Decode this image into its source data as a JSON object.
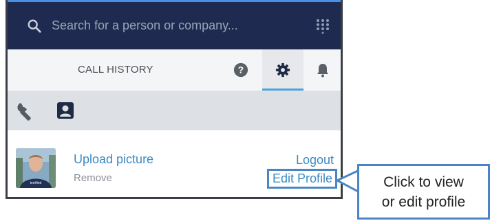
{
  "search": {
    "placeholder": "Search for a person or company..."
  },
  "tabs": {
    "call_history_label": "CALL HISTORY"
  },
  "profile": {
    "upload_label": "Upload picture",
    "remove_label": "Remove",
    "logout_label": "Logout",
    "edit_profile_label": "Edit Profile"
  },
  "callout": {
    "line1": "Click to view",
    "line2": "or edit profile"
  },
  "icons": {
    "search": "search-icon",
    "dialpad": "dialpad-icon",
    "help": "help-icon",
    "settings": "gear-icon",
    "notifications": "bell-icon",
    "tools": "wrench-icon",
    "contact_card": "contact-card-icon"
  },
  "colors": {
    "search_bar_bg": "#1e2a4f",
    "accent_blue": "#4a86c5",
    "link_blue": "#3c8ac2",
    "tab_underline": "#4aa3df"
  }
}
